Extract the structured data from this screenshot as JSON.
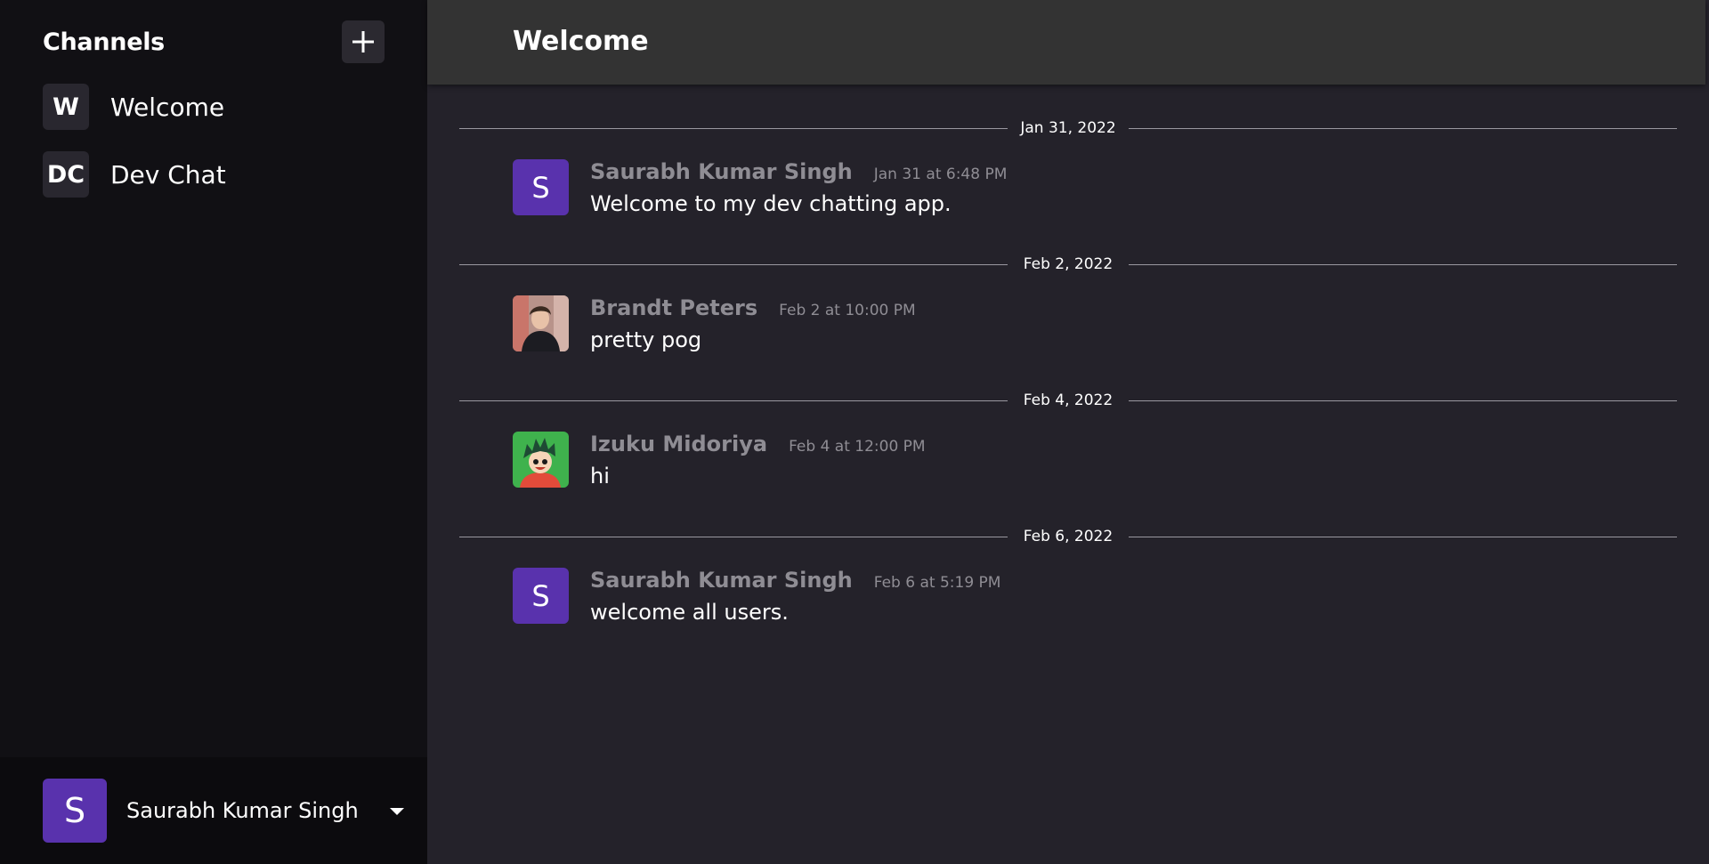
{
  "sidebar": {
    "title": "Channels",
    "add_icon": "plus-icon",
    "channels": [
      {
        "badge": "W",
        "name": "Welcome"
      },
      {
        "badge": "DC",
        "name": "Dev Chat"
      }
    ],
    "user": {
      "avatar_letter": "S",
      "name": "Saurabh Kumar Singh",
      "menu_icon": "caret-down-icon"
    }
  },
  "header": {
    "title": "Welcome"
  },
  "messages": [
    {
      "date": "Jan 31, 2022",
      "author": "Saurabh Kumar Singh",
      "time": "Jan 31 at 6:48 PM",
      "text": "Welcome to my dev chatting app.",
      "avatar_letter": "S"
    },
    {
      "date": "Feb 2, 2022",
      "author": "Brandt Peters",
      "time": "Feb 2 at 10:00 PM",
      "text": "pretty pog",
      "avatar_letter": ""
    },
    {
      "date": "Feb 4, 2022",
      "author": "Izuku Midoriya",
      "time": "Feb 4 at 12:00 PM",
      "text": "hi",
      "avatar_letter": ""
    },
    {
      "date": "Feb 6, 2022",
      "author": "Saurabh Kumar Singh",
      "time": "Feb 6 at 5:19 PM",
      "text": "welcome all users.",
      "avatar_letter": "S"
    }
  ],
  "colors": {
    "sidebar_bg": "#111014",
    "main_bg": "#24222a",
    "header_bg": "#333333",
    "accent": "#5932ad",
    "muted_text": "#8f8d94"
  }
}
